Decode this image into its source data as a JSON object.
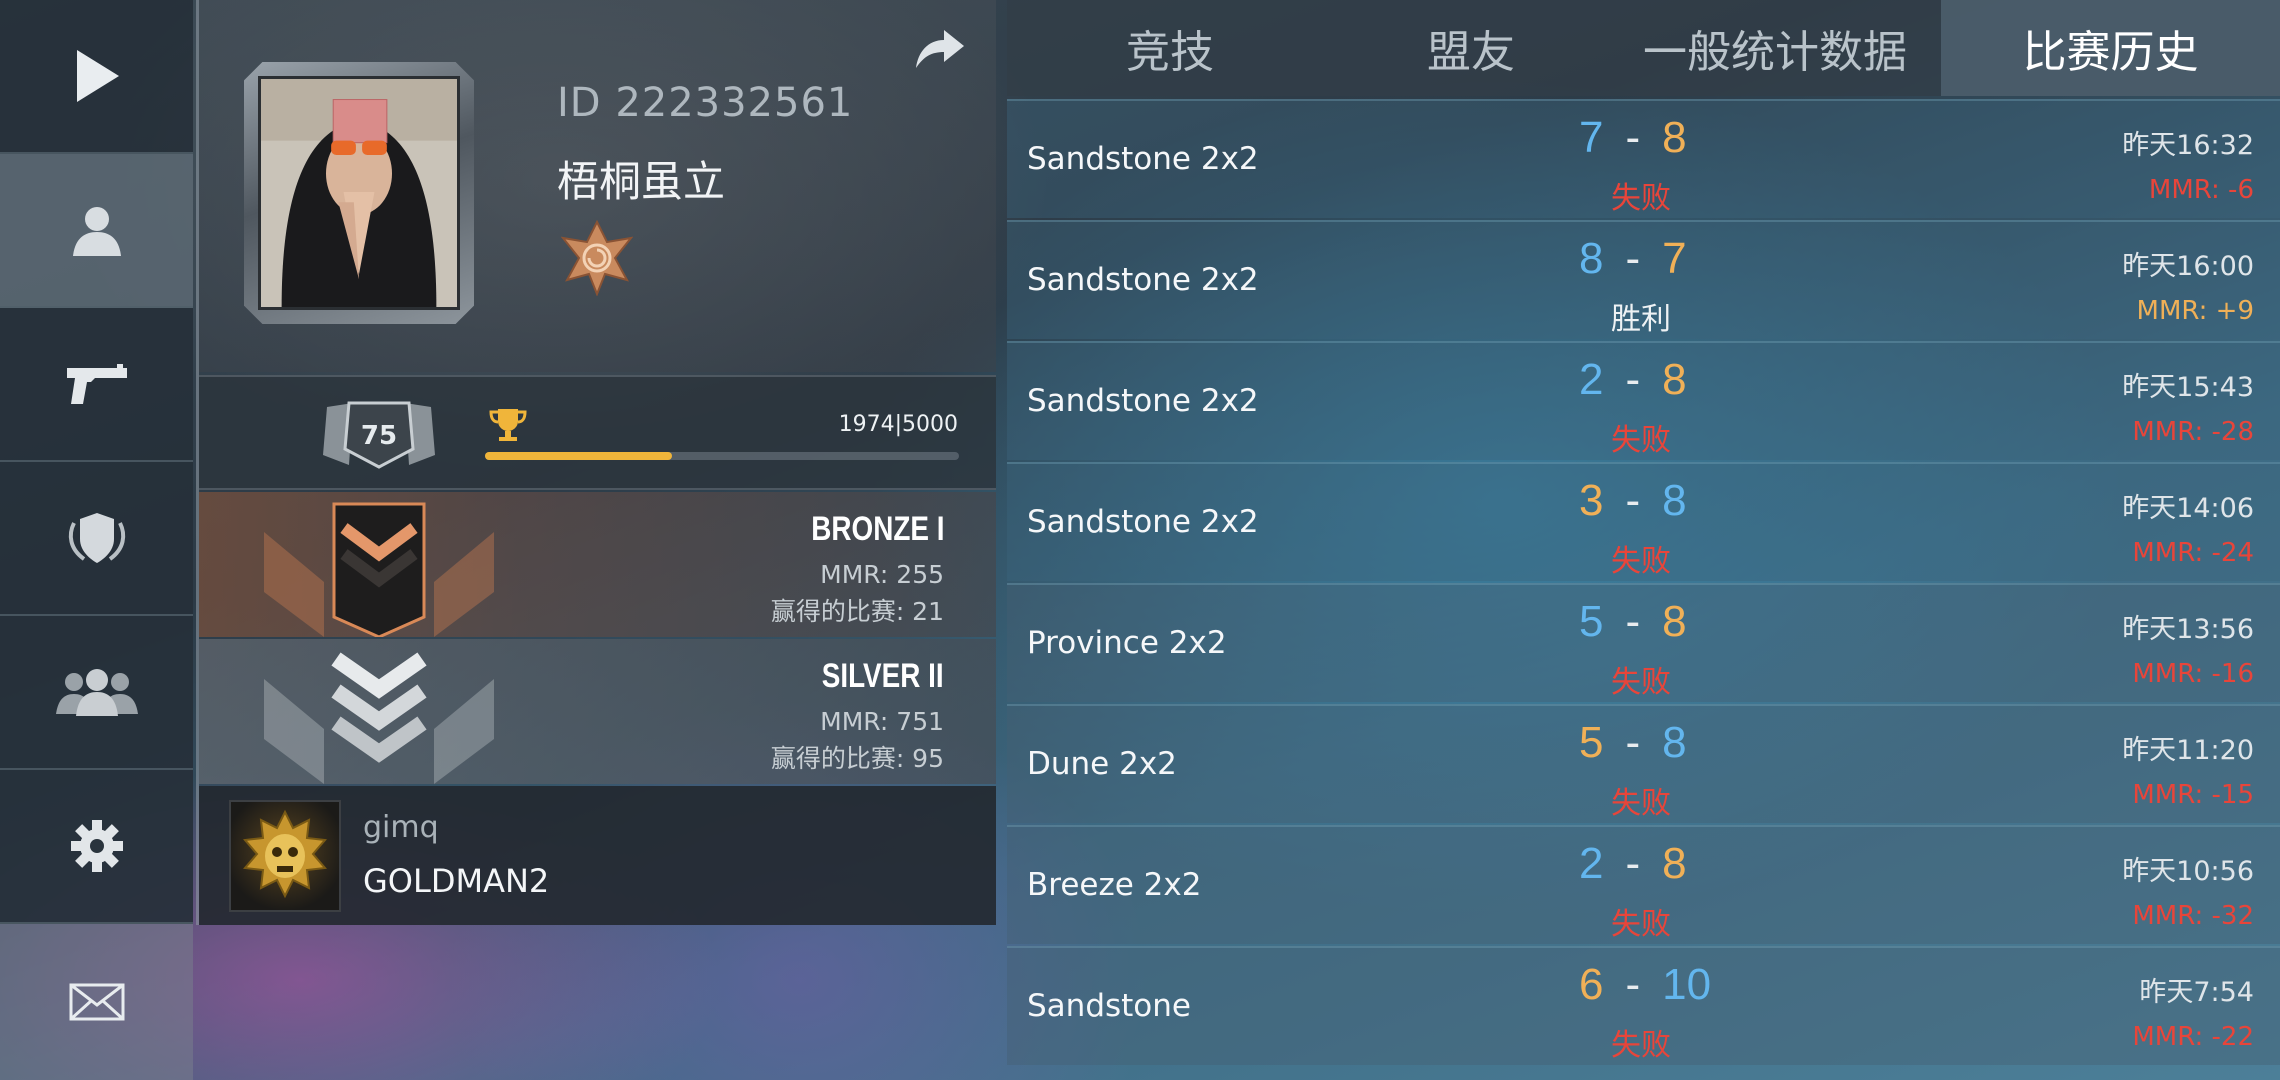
{
  "nav": {
    "items": [
      {
        "name": "play-icon"
      },
      {
        "name": "profile-icon"
      },
      {
        "name": "pistol-icon"
      },
      {
        "name": "shield-icon"
      },
      {
        "name": "friends-icon"
      },
      {
        "name": "gear-icon"
      },
      {
        "name": "mail-icon"
      }
    ],
    "active": "profile-icon"
  },
  "profile": {
    "id_text": "ID 222332561",
    "name": "梧桐虽立",
    "level": "75",
    "xp_text": "1974|5000",
    "xp_current": 1974,
    "xp_max": 5000,
    "ranks": [
      {
        "title": "BRONZE I",
        "mmr": "MMR: 255",
        "wins": "赢得的比赛: 21"
      },
      {
        "title": "SILVER II",
        "mmr": "MMR: 751",
        "wins": "赢得的比赛: 95"
      }
    ],
    "clan": {
      "tag": "gimq",
      "name": "GOLDMAN2"
    }
  },
  "tabs": [
    {
      "label": "竞技"
    },
    {
      "label": "盟友"
    },
    {
      "label": "一般统计数据"
    },
    {
      "label": "比赛历史",
      "active": true
    }
  ],
  "colors": {
    "team_blue": "#63b6ee",
    "team_orange": "#f0b057",
    "loss_red": "#e8453a",
    "xp_gold": "#f0b53a"
  },
  "matches": [
    {
      "map": "Sandstone 2x2",
      "score_a": "7",
      "score_b": "8",
      "color_a": "blue",
      "color_b": "orange",
      "result": "失败",
      "time": "昨天16:32",
      "mmr": "MMR: -6"
    },
    {
      "map": "Sandstone 2x2",
      "score_a": "8",
      "score_b": "7",
      "color_a": "blue",
      "color_b": "orange",
      "result": "胜利",
      "time": "昨天16:00",
      "mmr": "MMR: +9"
    },
    {
      "map": "Sandstone 2x2",
      "score_a": "2",
      "score_b": "8",
      "color_a": "blue",
      "color_b": "orange",
      "result": "失败",
      "time": "昨天15:43",
      "mmr": "MMR: -28"
    },
    {
      "map": "Sandstone 2x2",
      "score_a": "3",
      "score_b": "8",
      "color_a": "orange",
      "color_b": "blue",
      "result": "失败",
      "time": "昨天14:06",
      "mmr": "MMR: -24"
    },
    {
      "map": "Province 2x2",
      "score_a": "5",
      "score_b": "8",
      "color_a": "blue",
      "color_b": "orange",
      "result": "失败",
      "time": "昨天13:56",
      "mmr": "MMR: -16"
    },
    {
      "map": "Dune 2x2",
      "score_a": "5",
      "score_b": "8",
      "color_a": "orange",
      "color_b": "blue",
      "result": "失败",
      "time": "昨天11:20",
      "mmr": "MMR: -15"
    },
    {
      "map": "Breeze 2x2",
      "score_a": "2",
      "score_b": "8",
      "color_a": "blue",
      "color_b": "orange",
      "result": "失败",
      "time": "昨天10:56",
      "mmr": "MMR: -32"
    },
    {
      "map": "Sandstone",
      "score_a": "6",
      "score_b": "10",
      "color_a": "orange",
      "color_b": "blue",
      "result": "失败",
      "time": "昨天7:54",
      "mmr": "MMR: -22"
    }
  ]
}
